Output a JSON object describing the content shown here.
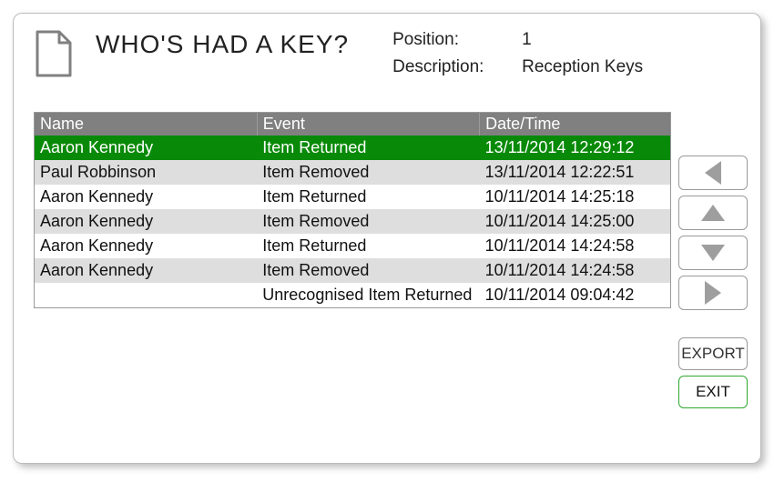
{
  "page": {
    "title": "WHO'S HAD A KEY?",
    "icon": "document-icon"
  },
  "meta": {
    "position_label": "Position:",
    "position_value": "1",
    "description_label": "Description:",
    "description_value": "Reception Keys"
  },
  "table": {
    "headers": {
      "name": "Name",
      "event": "Event",
      "datetime": "Date/Time"
    },
    "rows": [
      {
        "name": "Aaron Kennedy",
        "event": "Item Returned",
        "datetime": "13/11/2014 12:29:12",
        "selected": true
      },
      {
        "name": "Paul Robbinson",
        "event": "Item Removed",
        "datetime": "13/11/2014 12:22:51",
        "selected": false
      },
      {
        "name": "Aaron Kennedy",
        "event": "Item Returned",
        "datetime": "10/11/2014 14:25:18",
        "selected": false
      },
      {
        "name": "Aaron Kennedy",
        "event": "Item Removed",
        "datetime": "10/11/2014 14:25:00",
        "selected": false
      },
      {
        "name": "Aaron Kennedy",
        "event": "Item Returned",
        "datetime": "10/11/2014 14:24:58",
        "selected": false
      },
      {
        "name": "Aaron Kennedy",
        "event": "Item Removed",
        "datetime": "10/11/2014 14:24:58",
        "selected": false
      },
      {
        "name": "",
        "event": "Unrecognised Item Returned",
        "datetime": "10/11/2014 09:04:42",
        "selected": false
      }
    ]
  },
  "controls": {
    "left_icon": "triangle-left-icon",
    "up_icon": "triangle-up-icon",
    "down_icon": "triangle-down-icon",
    "right_icon": "triangle-right-icon",
    "export_label": "EXPORT",
    "exit_label": "EXIT"
  },
  "colors": {
    "header_bg": "#808080",
    "row_alt_bg": "#dedede",
    "row_selected_bg": "#088a08",
    "exit_border": "#2fa82f"
  }
}
